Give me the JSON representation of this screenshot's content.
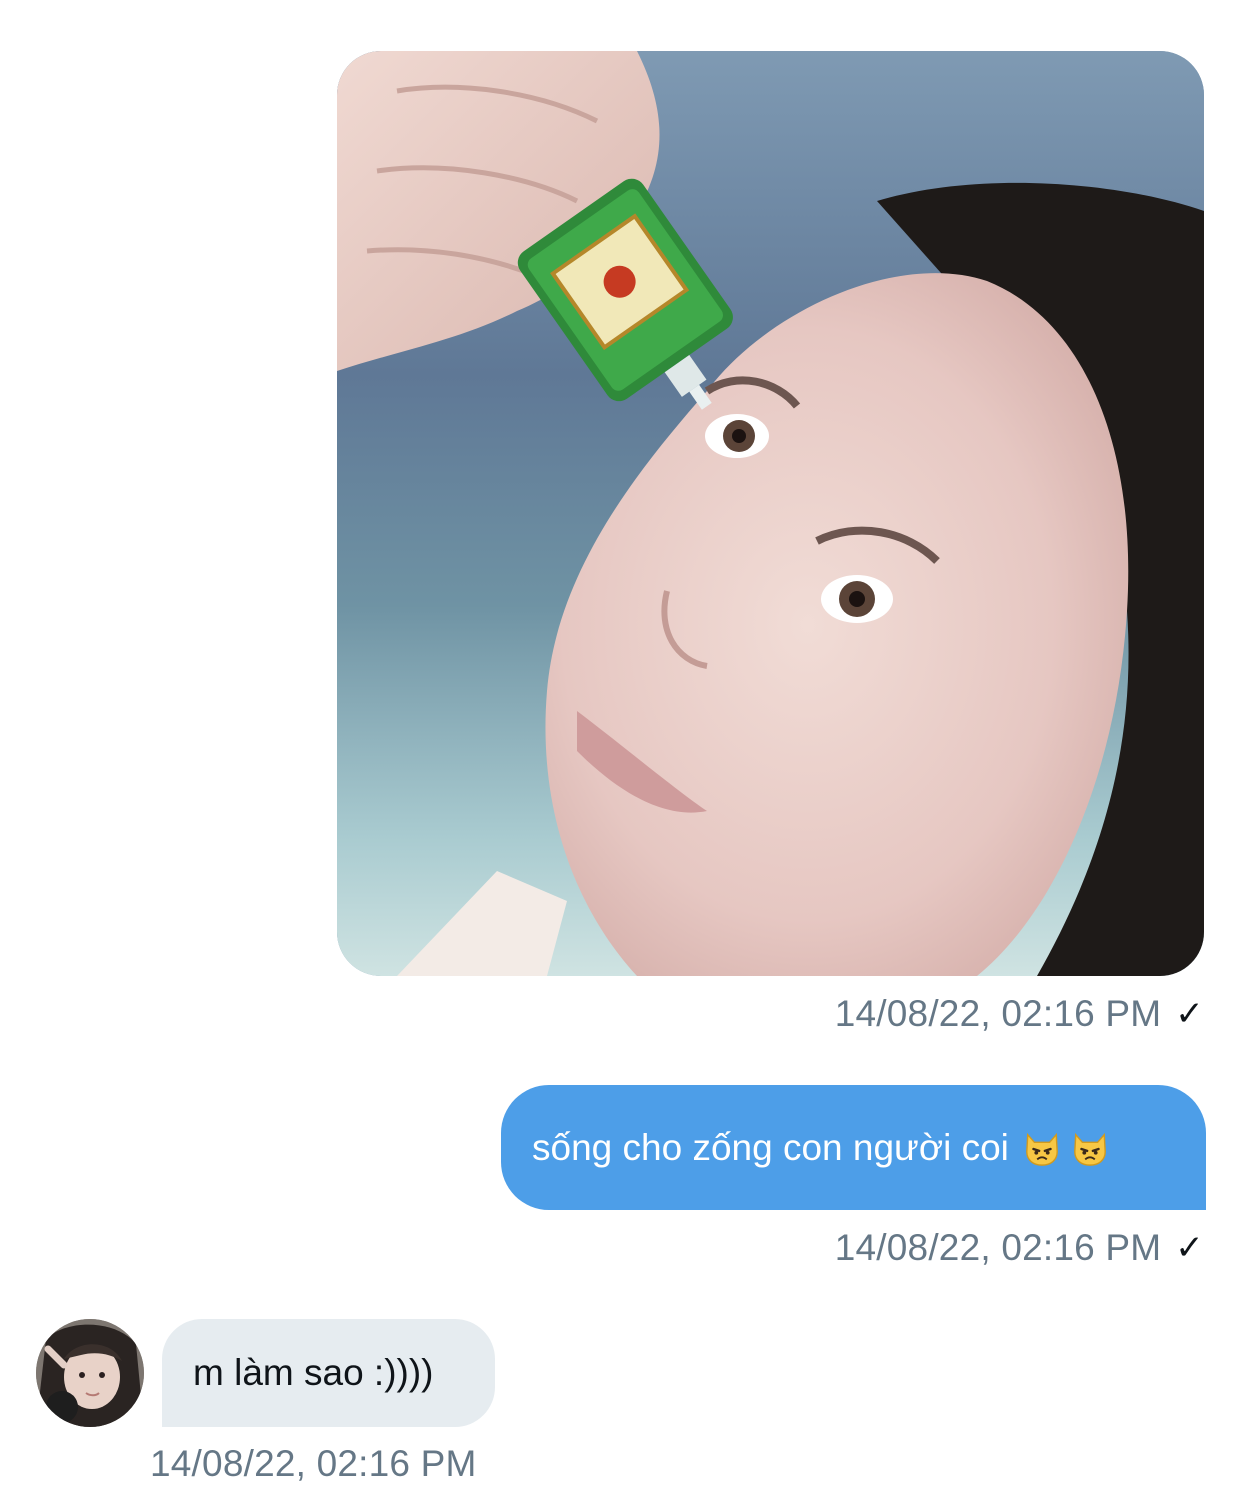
{
  "messages": [
    {
      "direction": "outgoing",
      "kind": "image",
      "image_alt": "meme-woman-applying-green-eye-drops",
      "timestamp": "14/08/22, 02:16 PM",
      "status_icon": "✓"
    },
    {
      "direction": "outgoing",
      "kind": "text",
      "text": "sống cho zống con người coi",
      "emojis": [
        "pouting-cat-icon",
        "pouting-cat-icon"
      ],
      "timestamp": "14/08/22, 02:16 PM",
      "status_icon": "✓"
    },
    {
      "direction": "incoming",
      "kind": "text",
      "text": "m làm sao :))))",
      "avatar": "user-avatar",
      "timestamp": "14/08/22, 02:16 PM"
    }
  ],
  "colors": {
    "outgoing_bubble": "#4d9ee8",
    "incoming_bubble": "#e6ecf0",
    "timestamp_text": "#657786",
    "background": "#ffffff"
  }
}
